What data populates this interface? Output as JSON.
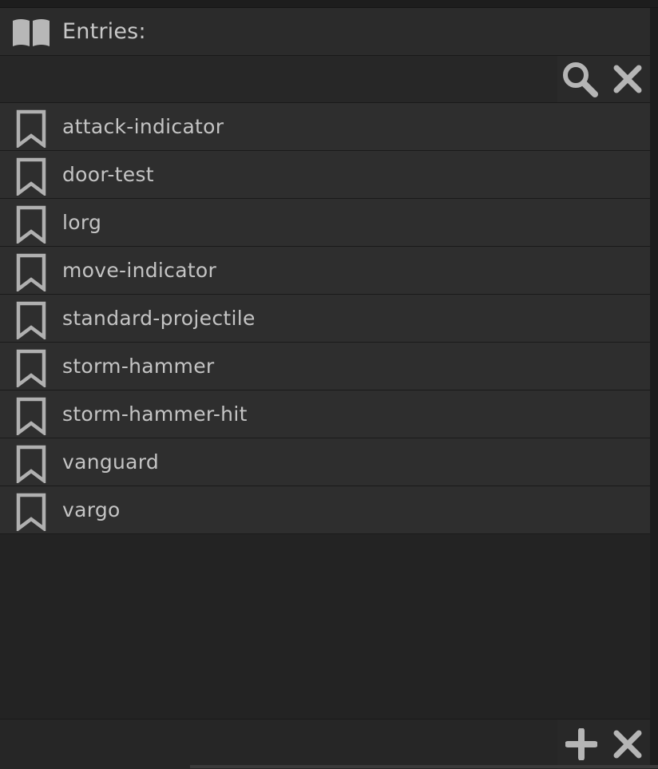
{
  "header": {
    "title": "Entries:",
    "icon": "book-icon"
  },
  "search": {
    "value": "",
    "placeholder": "",
    "search_icon": "search-icon",
    "clear_icon": "close-icon"
  },
  "entries": [
    {
      "label": "attack-indicator",
      "icon": "bookmark-icon"
    },
    {
      "label": "door-test",
      "icon": "bookmark-icon"
    },
    {
      "label": "lorg",
      "icon": "bookmark-icon"
    },
    {
      "label": "move-indicator",
      "icon": "bookmark-icon"
    },
    {
      "label": "standard-projectile",
      "icon": "bookmark-icon"
    },
    {
      "label": "storm-hammer",
      "icon": "bookmark-icon"
    },
    {
      "label": "storm-hammer-hit",
      "icon": "bookmark-icon"
    },
    {
      "label": "vanguard",
      "icon": "bookmark-icon"
    },
    {
      "label": "vargo",
      "icon": "bookmark-icon"
    }
  ],
  "footer": {
    "add_icon": "plus-icon",
    "remove_icon": "close-icon"
  },
  "colors": {
    "background": "#232323",
    "row": "#2e2e2e",
    "text": "#c4c4c4",
    "icon": "#b5b5b5"
  }
}
